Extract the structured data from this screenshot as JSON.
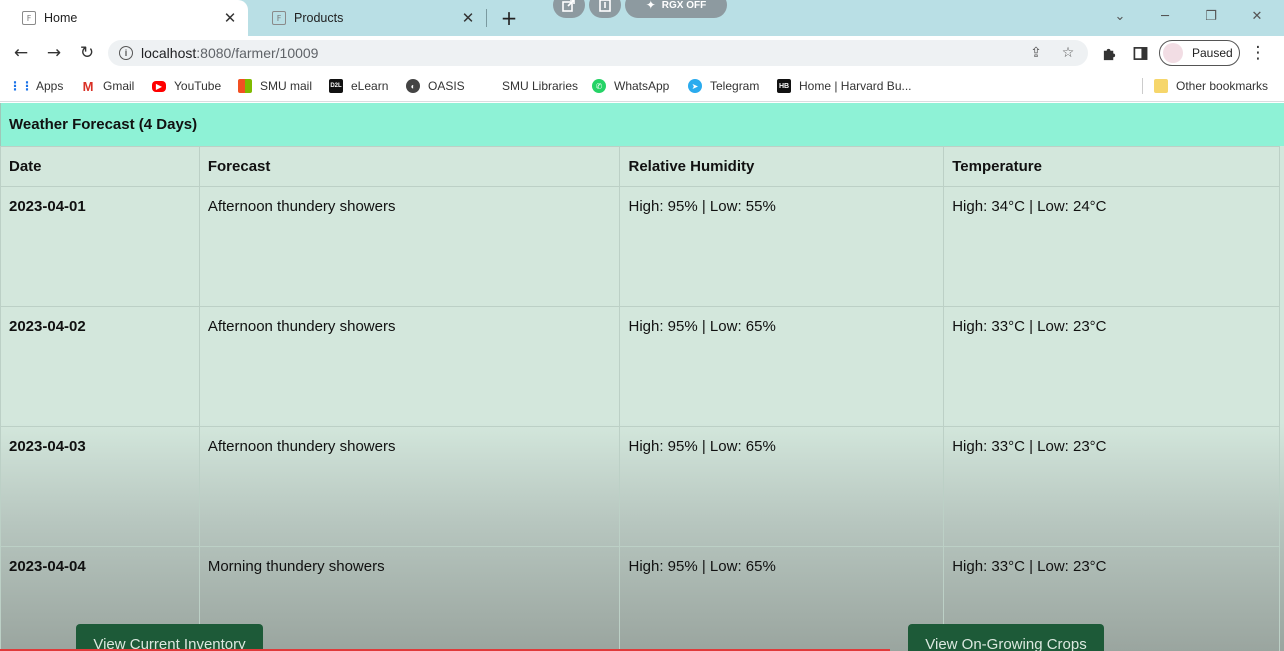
{
  "browser": {
    "tabs": [
      {
        "label": "Home",
        "favicon": "F"
      },
      {
        "label": "Products",
        "favicon": "F"
      }
    ],
    "overlay": {
      "rgx_label": "RGX OFF"
    },
    "url": {
      "host": "localhost",
      "rest": ":8080/farmer/10009"
    },
    "profile": {
      "label": "Paused"
    },
    "bookmarks": [
      {
        "label": "Apps",
        "icon": "apps-grid-icon",
        "color": "#1a73e8"
      },
      {
        "label": "Gmail",
        "icon": "gmail-icon",
        "color": "#d93025"
      },
      {
        "label": "YouTube",
        "icon": "youtube-icon",
        "color": "#ff0000"
      },
      {
        "label": "SMU mail",
        "icon": "microsoft-icon",
        "color": "#0078d4"
      },
      {
        "label": "eLearn",
        "icon": "d2l-icon",
        "color": "#111111"
      },
      {
        "label": "OASIS",
        "icon": "globe-icon",
        "color": "#444444"
      },
      {
        "label": "SMU Libraries",
        "icon": "blank-icon",
        "color": "#ffffff"
      },
      {
        "label": "WhatsApp",
        "icon": "whatsapp-icon",
        "color": "#25d366"
      },
      {
        "label": "Telegram",
        "icon": "telegram-icon",
        "color": "#2aabee"
      },
      {
        "label": "Home | Harvard Bu...",
        "icon": "hb-icon",
        "color": "#111111"
      }
    ],
    "other_bookmarks": "Other bookmarks"
  },
  "forecast": {
    "title": "Weather Forecast (4 Days)",
    "headers": {
      "date": "Date",
      "forecast": "Forecast",
      "humidity": "Relative Humidity",
      "temperature": "Temperature"
    },
    "rows": [
      {
        "date": "2023-04-01",
        "forecast": "Afternoon thundery showers",
        "humidity": "High: 95% | Low: 55%",
        "temperature": "High: 34°C | Low: 24°C"
      },
      {
        "date": "2023-04-02",
        "forecast": "Afternoon thundery showers",
        "humidity": "High: 95% | Low: 65%",
        "temperature": "High: 33°C | Low: 23°C"
      },
      {
        "date": "2023-04-03",
        "forecast": "Afternoon thundery showers",
        "humidity": "High: 95% | Low: 65%",
        "temperature": "High: 33°C | Low: 23°C"
      },
      {
        "date": "2023-04-04",
        "forecast": "Morning thundery showers",
        "humidity": "High: 95% | Low: 65%",
        "temperature": "High: 33°C | Low: 23°C"
      }
    ]
  },
  "actions": {
    "inventory_label": "View Current Inventory",
    "crops_label": "View On-Growing Crops"
  },
  "colors": {
    "header_bg": "#8ef2d6",
    "button_bg": "#1d5a38",
    "tabstrip_bg": "#b9dfe5"
  }
}
